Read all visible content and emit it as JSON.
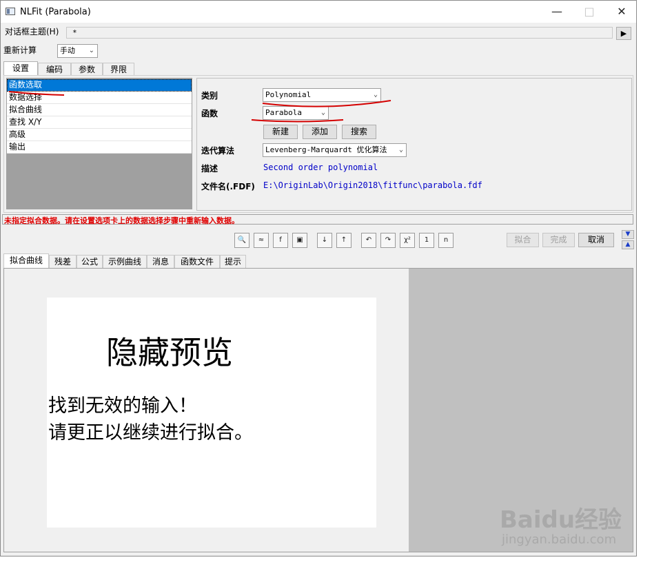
{
  "window": {
    "title": "NLFit (Parabola)"
  },
  "top": {
    "theme_label": "对话框主题(H)",
    "theme_value": "*",
    "recalc_label": "重新计算",
    "recalc_value": "手动"
  },
  "tabs": [
    "设置",
    "编码",
    "参数",
    "界限"
  ],
  "steps": [
    "函数选取",
    "数据选择",
    "拟合曲线",
    "查找 X/Y",
    "高级",
    "输出"
  ],
  "settings": {
    "category_label": "类别",
    "category_value": "Polynomial",
    "function_label": "函数",
    "function_value": "Parabola",
    "new_button": "新建",
    "add_button": "添加",
    "search_button": "搜索",
    "algorithm_label": "迭代算法",
    "algorithm_value": "Levenberg-Marquardt 优化算法",
    "description_label": "描述",
    "description_value": "Second order polynomial",
    "filename_label": "文件名(.FDF)",
    "filename_value": "E:\\OriginLab\\Origin2018\\fitfunc\\parabola.fdf"
  },
  "status": {
    "message": "未指定拟合数据。请在设置选项卡上的数据选择步骤中重新输入数据。",
    "color": "#e00000"
  },
  "toolbar": {
    "icons": [
      "zoom-data-icon",
      "fit-until-converge-icon",
      "fx-edit-icon",
      "save-icon",
      "iterate-icon",
      "graph-update-icon",
      "undo-icon",
      "redo-icon",
      "chi-square-icon",
      "one-iteration-icon",
      "fit-iterations-icon"
    ],
    "fit_button": "拟合",
    "done_button": "完成",
    "cancel_button": "取消"
  },
  "bottom_tabs": [
    "拟合曲线",
    "残差",
    "公式",
    "示例曲线",
    "消息",
    "函数文件",
    "提示"
  ],
  "preview": {
    "heading": "隐藏预览",
    "line1": "找到无效的输入！",
    "line2": "请更正以继续进行拟合。"
  },
  "watermark": {
    "brand": "Baidu经验",
    "url": "jingyan.baidu.com"
  },
  "colors": {
    "selection": "#0078d7",
    "error": "#e00000",
    "value_text": "#0000c8",
    "annotation": "#d40000"
  }
}
